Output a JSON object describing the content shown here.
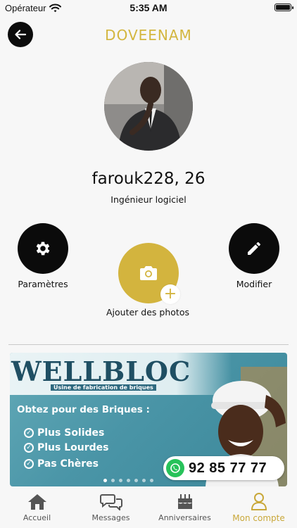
{
  "status_bar": {
    "carrier": "Opérateur",
    "time": "5:35 AM"
  },
  "header": {
    "title": "DOVEENAM",
    "back_icon": "arrow-left-icon"
  },
  "profile": {
    "name_age": "farouk228, 26",
    "job": "Ingénieur logiciel"
  },
  "actions": {
    "settings_label": "Paramètres",
    "edit_label": "Modifier",
    "add_photos_label": "Ajouter des photos"
  },
  "ad": {
    "brand": "WELLBLOC",
    "tagline": "Usine de fabrication de briques",
    "headline": "Obtez pour des Briques :",
    "points": [
      "Plus Solides",
      "Plus Lourdes",
      "Pas Chères"
    ],
    "phone": "92 85 77 77",
    "carousel_pages": 7,
    "carousel_active": 1
  },
  "tabs": [
    {
      "label": "Accueil",
      "icon": "home-icon"
    },
    {
      "label": "Messages",
      "icon": "chat-bubbles-icon"
    },
    {
      "label": "Anniversaires",
      "icon": "birthday-cake-icon"
    },
    {
      "label": "Mon compte",
      "icon": "user-icon",
      "active": true
    }
  ],
  "colors": {
    "accent": "#d3b43e",
    "dark": "#0b0b0b",
    "background": "#f7f7f7"
  }
}
